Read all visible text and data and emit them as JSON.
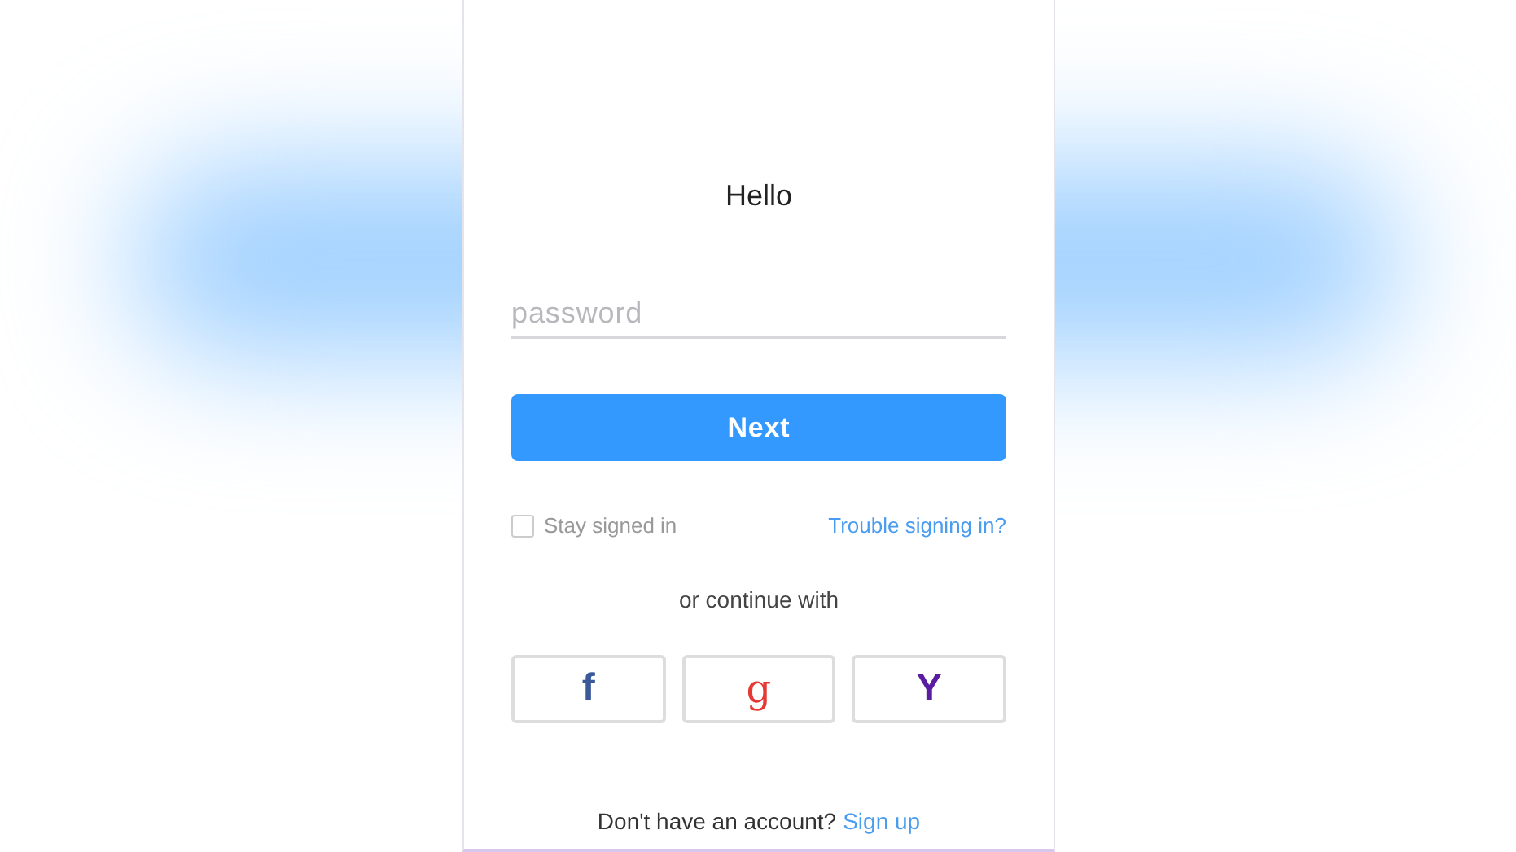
{
  "title": "Hello",
  "password": {
    "placeholder": "password"
  },
  "next_button": "Next",
  "stay_signed_in": {
    "label": "Stay signed in",
    "checked": false
  },
  "trouble_link": "Trouble signing in?",
  "divider_text": "or continue with",
  "social_buttons": [
    {
      "label": "f",
      "color": "#3b5998",
      "kind": "sans"
    },
    {
      "label": "g",
      "color": "#e53935",
      "kind": "serif"
    },
    {
      "label": "Y",
      "color": "#5a1ca0",
      "kind": "sans"
    }
  ],
  "footer": {
    "text": "Don't have an account?",
    "link": "Sign up"
  }
}
